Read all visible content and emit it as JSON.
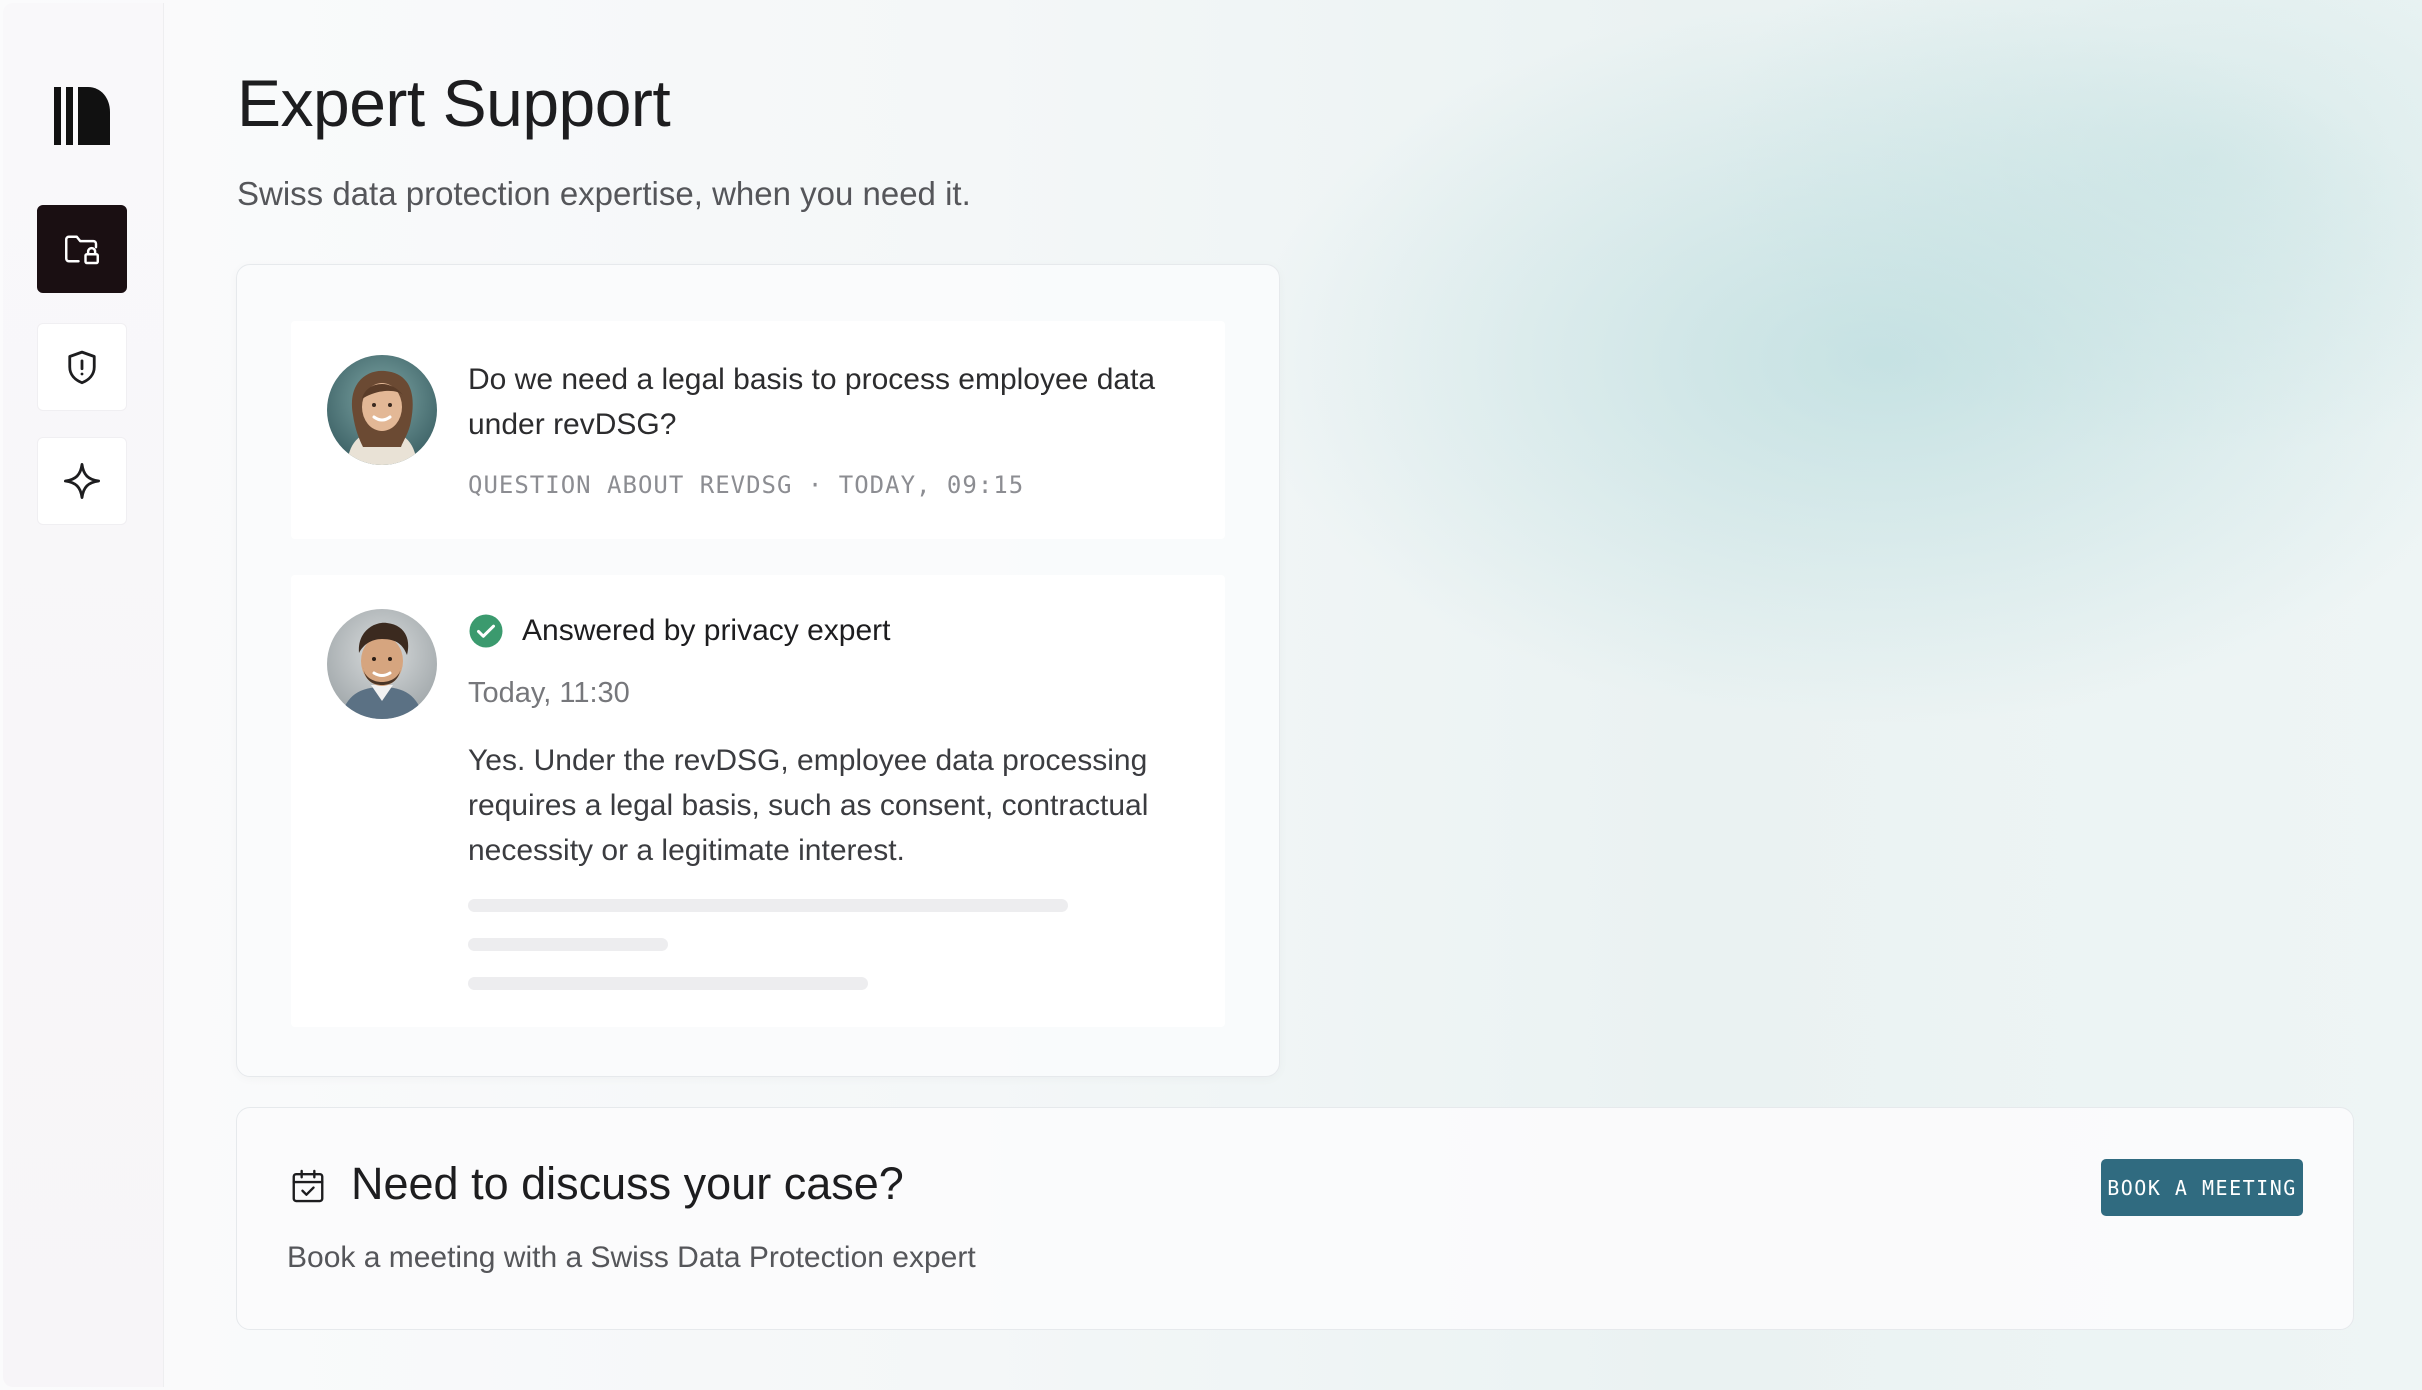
{
  "page": {
    "title": "Expert Support",
    "subtitle": "Swiss data protection expertise, when you need it."
  },
  "sidebar": {
    "items": [
      {
        "name": "folder-lock",
        "icon": "folder-lock-icon",
        "active": true
      },
      {
        "name": "shield-alert",
        "icon": "shield-alert-icon",
        "active": false
      },
      {
        "name": "sparkle",
        "icon": "sparkle-icon",
        "active": false
      }
    ]
  },
  "question": {
    "text": "Do we need a legal basis to process employee data under revDSG?",
    "meta": "QUESTION ABOUT REVDSG · TODAY, 09:15"
  },
  "answer": {
    "status": "Answered by privacy expert",
    "time": "Today, 11:30",
    "text": "Yes. Under the revDSG, employee data processing requires a legal basis, such as consent, contractual necessity or a legitimate interest."
  },
  "cta": {
    "title": "Need to discuss your case?",
    "subtitle": "Book a meeting with a Swiss Data Protection expert",
    "button_label": "BOOK A MEETING"
  },
  "colors": {
    "accent": "#306b80",
    "active_nav": "#1a0f12",
    "success": "#3b9a6e"
  }
}
